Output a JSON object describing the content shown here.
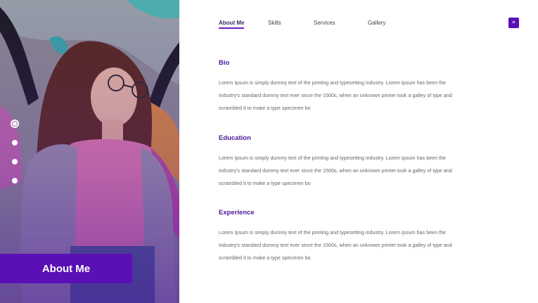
{
  "hero": {
    "badge_label": "About Me"
  },
  "pager": {
    "dots": 4,
    "active_index": 0
  },
  "nav": {
    "items": [
      {
        "label": "About Me",
        "active": true
      },
      {
        "label": "Skills",
        "active": false
      },
      {
        "label": "Services",
        "active": false
      },
      {
        "label": "Gallery",
        "active": false
      }
    ],
    "next_icon": "double-chevron-right-icon",
    "next_glyph": "»"
  },
  "sections": [
    {
      "title": "Bio",
      "text": "Lorem Ipsum is simply dummy text of the printing and typesetting industry. Lorem Ipsum has been the industry's standard dummy text ever since the 1500s, when an unknown printer took a galley of type and scrambled it to make a type specimen bo"
    },
    {
      "title": "Education",
      "text": "Lorem Ipsum is simply dummy text of the printing and typesetting industry. Lorem Ipsum has been the industry's standard dummy text ever since the 1500s, when an unknown printer took a galley of type and scrambled it to make a type specimen bo"
    },
    {
      "title": "Experience",
      "text": "Lorem Ipsum is simply dummy text of the printing and typesetting industry. Lorem Ipsum has been the industry's standard dummy text ever since the 1500s, when an unknown printer took a galley of type and scrambled it to make a type specimen bo"
    }
  ],
  "colors": {
    "accent": "#5a10b4",
    "heading": "#4a1a98",
    "body_text": "#666666"
  }
}
